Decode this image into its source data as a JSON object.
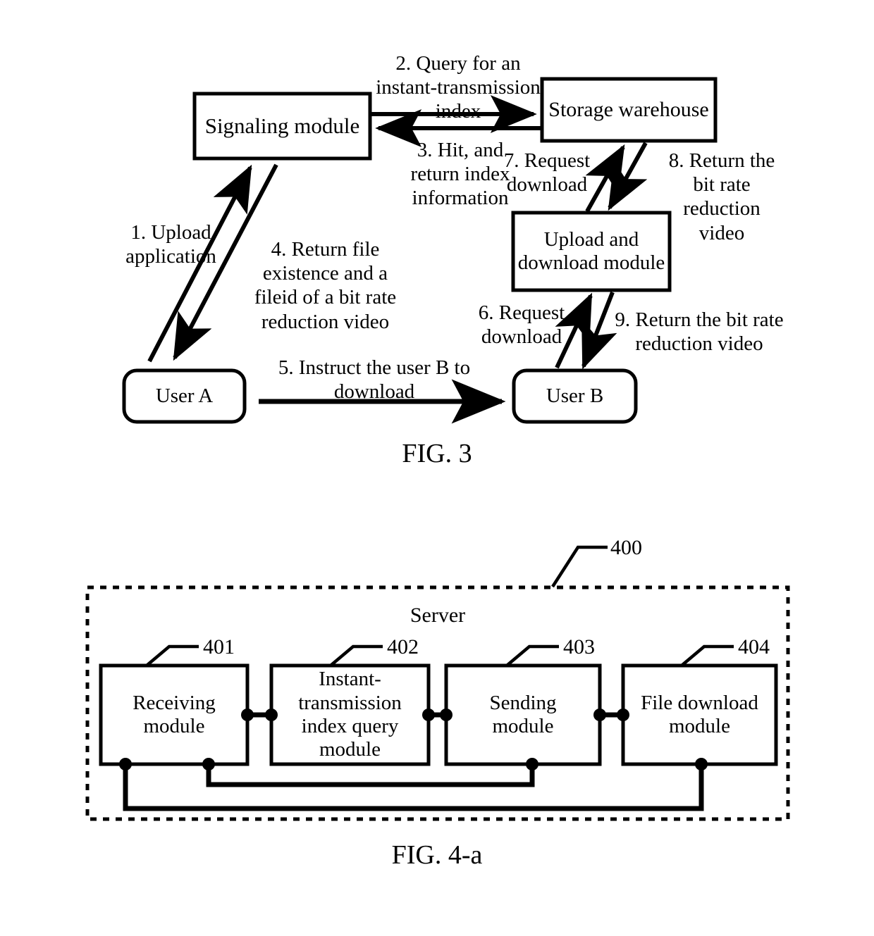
{
  "figures": [
    {
      "id": "fig3",
      "caption": "FIG. 3",
      "nodes": {
        "signaling_module": "Signaling module",
        "storage_warehouse": "Storage warehouse",
        "upload_download_module": "Upload and\ndownload module",
        "user_a": "User A",
        "user_b": "User B"
      },
      "flow_labels": {
        "step1": "1. Upload\napplication",
        "step2": "2. Query for an\ninstant-transmission\nindex",
        "step3": "3. Hit, and\nreturn index\ninformation",
        "step4": "4. Return file\nexistence and a\nfileid of a bit rate\nreduction video",
        "step5": "5. Instruct the user B to\ndownload",
        "step6": "6. Request\ndownload",
        "step7": "7. Request\ndownload",
        "step8": "8. Return the\nbit rate\nreduction video",
        "step9": "9. Return the bit rate\nreduction video"
      }
    },
    {
      "id": "fig4a",
      "caption": "FIG. 4-a",
      "container_label": "Server",
      "container_ref": "400",
      "modules": [
        {
          "ref": "401",
          "label": "Receiving\nmodule"
        },
        {
          "ref": "402",
          "label": "Instant-\ntransmission\nindex query\nmodule"
        },
        {
          "ref": "403",
          "label": "Sending\nmodule"
        },
        {
          "ref": "404",
          "label": "File download\nmodule"
        }
      ]
    }
  ],
  "colors": {
    "ink": "#000000",
    "paper": "#ffffff"
  }
}
